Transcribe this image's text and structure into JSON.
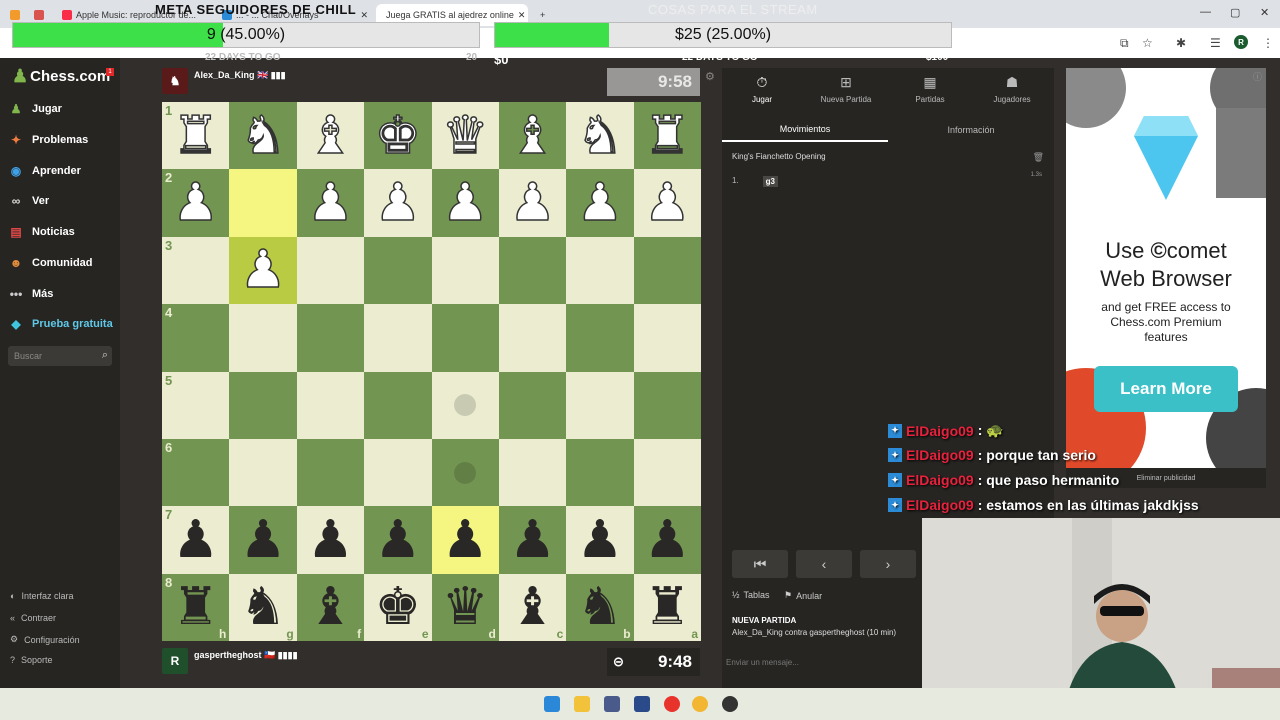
{
  "browser": {
    "tabs": [
      {
        "label": "Apple Music: reproductor de...",
        "active": false
      },
      {
        "label": "... - ... Chat/Overlays",
        "active": false
      },
      {
        "label": "Juega GRATIS al ajedrez online",
        "active": true
      }
    ],
    "new_tab_label": "+"
  },
  "overlay": {
    "left_goal": {
      "title": "META SEGUIDORES DE CHILL",
      "value_text": "9 (45.00%)",
      "fill_fraction": 0.45,
      "sub_left": "22 DAYS TO GO",
      "sub_right": "20"
    },
    "right_goal": {
      "title": "COSAS PARA EL STREAM",
      "value_text": "$25 (25.00%)",
      "fill_fraction": 0.25,
      "sub_left": "$0",
      "sub_center": "22 DAYS TO GO",
      "sub_right": "$100"
    }
  },
  "sidebar": {
    "logo": "Chess.com",
    "badge": "1",
    "items": [
      {
        "label": "Jugar",
        "icon": "pawn-icon"
      },
      {
        "label": "Problemas",
        "icon": "puzzle-icon"
      },
      {
        "label": "Aprender",
        "icon": "learn-icon"
      },
      {
        "label": "Ver",
        "icon": "binoculars-icon"
      },
      {
        "label": "Noticias",
        "icon": "news-icon"
      },
      {
        "label": "Comunidad",
        "icon": "community-icon"
      },
      {
        "label": "Más",
        "icon": "more-icon"
      },
      {
        "label": "Prueba gratuita",
        "icon": "diamond-icon"
      }
    ],
    "search_placeholder": "Buscar",
    "bottom": [
      "Interfaz clara",
      "Contraer",
      "Configuración",
      "Soporte"
    ]
  },
  "game": {
    "top_player": {
      "name": "Alex_Da_King 🇬🇧 ▮▮▮",
      "clock": "9:58"
    },
    "bottom_player": {
      "name": "gaspertheghost 🇨🇱 ▮▮▮▮",
      "avatar": "R",
      "clock": "9:48"
    },
    "ranks": [
      "1",
      "2",
      "3",
      "4",
      "5",
      "6",
      "7",
      "8"
    ],
    "files": [
      "h",
      "g",
      "f",
      "e",
      "d",
      "c",
      "b",
      "a"
    ]
  },
  "panel": {
    "tabs": [
      {
        "label": "Jugar",
        "icon": "clock-icon",
        "active": true
      },
      {
        "label": "Nueva Partida",
        "icon": "plus-icon",
        "active": false
      },
      {
        "label": "Partidas",
        "icon": "board-icon",
        "active": false
      },
      {
        "label": "Jugadores",
        "icon": "players-icon",
        "active": false
      }
    ],
    "subtabs": [
      "Movimientos",
      "Información"
    ],
    "opening": "King's Fianchetto Opening",
    "moves": [
      {
        "num": "1.",
        "white": "g3",
        "time": "1.3s"
      }
    ],
    "actions": [
      {
        "icon": "½",
        "label": "Tablas"
      },
      {
        "icon": "⚑",
        "label": "Anular"
      }
    ],
    "new_game_heading": "NUEVA PARTIDA",
    "new_game_text": "Alex_Da_King contra gaspertheghost (10 min)",
    "message_placeholder": "Enviar un mensaje..."
  },
  "ad": {
    "use": "Use",
    "brand": "comet",
    "line2": "Web Browser",
    "body": "and get FREE access to Chess.com Premium features",
    "cta": "Learn More",
    "remove": "Eliminar publicidad"
  },
  "chat": [
    {
      "user": "ElDaigo09",
      "text": ": 🐢"
    },
    {
      "user": "ElDaigo09",
      "text": ": porque tan serio"
    },
    {
      "user": "ElDaigo09",
      "text": ": que paso hermanito"
    },
    {
      "user": "ElDaigo09",
      "text": ": estamos en las últimas jakdkjss"
    }
  ],
  "colors": {
    "board_light": "#ebecd0",
    "board_dark": "#739552",
    "highlight": "#f5f682",
    "accent": "#81b64c",
    "chat_user": "#e8223d"
  }
}
